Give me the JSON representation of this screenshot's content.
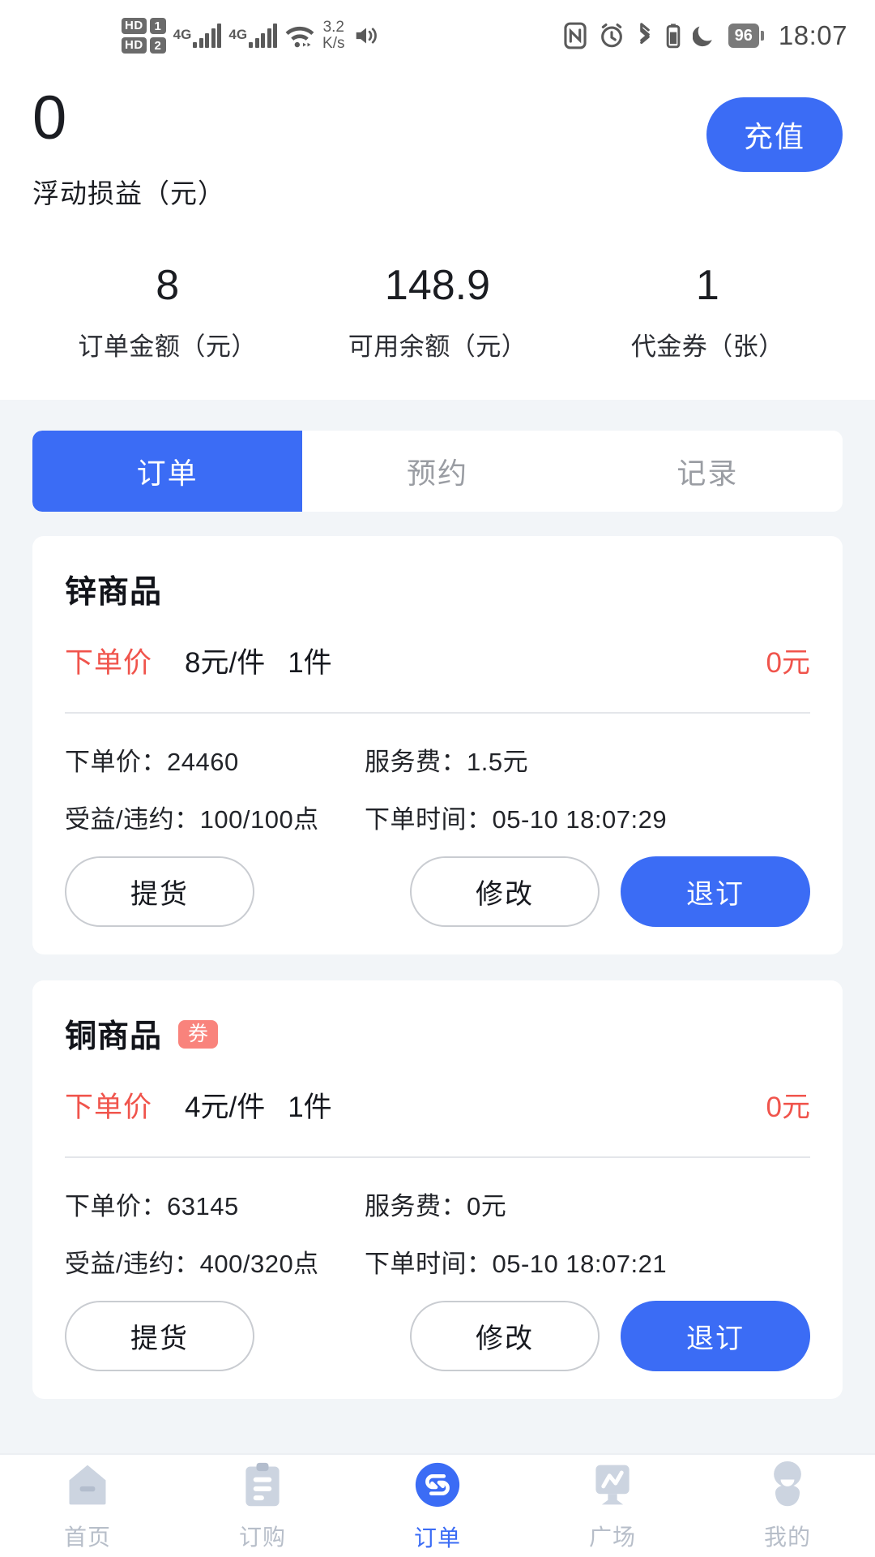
{
  "status_bar": {
    "hd1": "HD",
    "sim1": "1",
    "hd2": "HD",
    "sim2": "2",
    "net1": "4G",
    "net2": "4G",
    "speed_value": "3.2",
    "speed_unit": "K/s",
    "battery": "96",
    "time": "18:07",
    "icons": [
      "hd-dual-sim-icon",
      "signal-4g-icon",
      "wifi-icon",
      "volume-icon",
      "nfc-icon",
      "alarm-icon",
      "bluetooth-icon",
      "dnd-moon-icon",
      "battery-icon"
    ]
  },
  "header": {
    "pnl_value": "0",
    "pnl_label": "浮动损益（元）",
    "recharge_label": "充值",
    "stats": [
      {
        "value": "8",
        "label": "订单金额（元）"
      },
      {
        "value": "148.9",
        "label": "可用余额（元）"
      },
      {
        "value": "1",
        "label": "代金券（张）"
      }
    ]
  },
  "tabs": [
    {
      "label": "订单",
      "active": true
    },
    {
      "label": "预约",
      "active": false
    },
    {
      "label": "记录",
      "active": false
    }
  ],
  "orders": [
    {
      "title": "锌商品",
      "badge": "",
      "price_tag": "下单价",
      "price": "8元/件",
      "qty": "1件",
      "total": "0元",
      "detail_price_label": "下单价：",
      "detail_price_value": "24460",
      "fee_label": "服务费：",
      "fee_value": "1.5元",
      "profit_label": "受益/违约：",
      "profit_value": "100/100点",
      "time_label": "下单时间：",
      "time_value": "05-10 18:07:29",
      "btn_pickup": "提货",
      "btn_modify": "修改",
      "btn_cancel": "退订"
    },
    {
      "title": "铜商品",
      "badge": "券",
      "price_tag": "下单价",
      "price": "4元/件",
      "qty": "1件",
      "total": "0元",
      "detail_price_label": "下单价：",
      "detail_price_value": "63145",
      "fee_label": "服务费：",
      "fee_value": "0元",
      "profit_label": "受益/违约：",
      "profit_value": "400/320点",
      "time_label": "下单时间：",
      "time_value": "05-10 18:07:21",
      "btn_pickup": "提货",
      "btn_modify": "修改",
      "btn_cancel": "退订"
    }
  ],
  "bottom_nav": [
    {
      "label": "首页",
      "icon": "home-icon",
      "active": false
    },
    {
      "label": "订购",
      "icon": "clipboard-icon",
      "active": false
    },
    {
      "label": "订单",
      "icon": "swap-arrows-icon",
      "active": true
    },
    {
      "label": "广场",
      "icon": "chart-icon",
      "active": false
    },
    {
      "label": "我的",
      "icon": "person-icon",
      "active": false
    }
  ],
  "colors": {
    "accent": "#3b6cf5",
    "danger": "#f0544c",
    "coupon": "#f9837c",
    "page_bg": "#f2f5f8",
    "muted": "#9a9da3"
  }
}
